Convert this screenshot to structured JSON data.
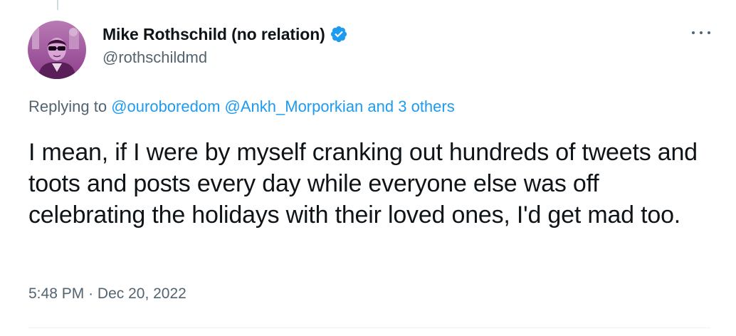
{
  "tweet": {
    "author": {
      "display_name": "Mike Rothschild (no relation)",
      "handle": "@rothschildmd",
      "verified": true,
      "avatar_icon": "avatar-photo",
      "brand_color": "#1d9bf0"
    },
    "more_icon": "more-horizontal-icon",
    "replying": {
      "prefix": "Replying to",
      "mention1": "@ouroboredom",
      "mention2": "@Ankh_Morporkian",
      "others": "and 3 others"
    },
    "text": "I mean, if I were by myself cranking out hundreds of tweets and toots and posts every day while everyone else was off celebrating the holidays with their loved ones, I'd get mad too.",
    "time": "5:48 PM",
    "separator": "·",
    "date": "Dec 20, 2022"
  }
}
